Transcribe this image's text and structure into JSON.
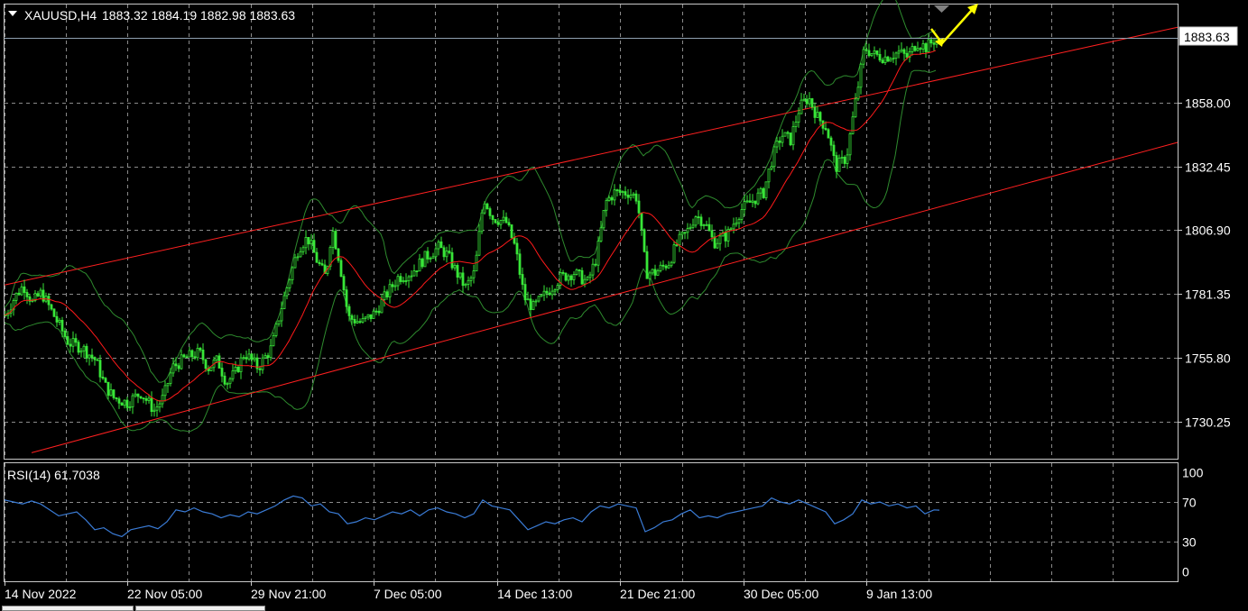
{
  "colors": {
    "background": "#000000",
    "candle": "#39e639",
    "bollinger": "#2e8b2e",
    "ma": "#ff1a1a",
    "channel": "#ff2020",
    "rsi": "#3a7bd5",
    "arrow": "#ffff00",
    "grid": "#8a8a8a",
    "price_line": "#8fa0b0"
  },
  "header": {
    "symbol_label": "XAUUSD,H4",
    "ohlc_text": "1883.32 1884.19 1882.98 1883.63",
    "collapse_icon": "triangle-down-icon"
  },
  "rsi_panel": {
    "label": "RSI(14) 61.7038"
  },
  "price_tag": "1883.63",
  "chart_data": [
    {
      "type": "candlestick",
      "title": "XAUUSD,H4",
      "y_ticks": [
        "1883.63",
        "1858.00",
        "1832.45",
        "1806.90",
        "1781.35",
        "1755.80",
        "1730.25"
      ],
      "ylim": [
        1716,
        1896
      ],
      "x_ticks": [
        "14 Nov 2022",
        "22 Nov 05:00",
        "29 Nov 21:00",
        "7 Dec 05:00",
        "14 Dec 13:00",
        "21 Dec 21:00",
        "30 Dec 05:00",
        "9 Jan 13:00"
      ],
      "last_price": 1883.63,
      "grid": true,
      "close_trace": [
        [
          0,
          1773
        ],
        [
          10,
          1780
        ],
        [
          20,
          1785
        ],
        [
          30,
          1778
        ],
        [
          40,
          1782
        ],
        [
          55,
          1772
        ],
        [
          70,
          1762
        ],
        [
          85,
          1760
        ],
        [
          100,
          1755
        ],
        [
          110,
          1745
        ],
        [
          120,
          1740
        ],
        [
          135,
          1738
        ],
        [
          150,
          1742
        ],
        [
          165,
          1735
        ],
        [
          175,
          1740
        ],
        [
          185,
          1752
        ],
        [
          200,
          1756
        ],
        [
          215,
          1758
        ],
        [
          225,
          1752
        ],
        [
          235,
          1755
        ],
        [
          245,
          1746
        ],
        [
          255,
          1750
        ],
        [
          265,
          1758
        ],
        [
          280,
          1752
        ],
        [
          295,
          1760
        ],
        [
          305,
          1775
        ],
        [
          315,
          1788
        ],
        [
          325,
          1800
        ],
        [
          335,
          1804
        ],
        [
          345,
          1795
        ],
        [
          355,
          1788
        ],
        [
          362,
          1808
        ],
        [
          370,
          1795
        ],
        [
          380,
          1772
        ],
        [
          395,
          1770
        ],
        [
          410,
          1774
        ],
        [
          420,
          1780
        ],
        [
          435,
          1788
        ],
        [
          450,
          1790
        ],
        [
          465,
          1796
        ],
        [
          480,
          1800
        ],
        [
          490,
          1797
        ],
        [
          500,
          1790
        ],
        [
          510,
          1784
        ],
        [
          520,
          1790
        ],
        [
          530,
          1820
        ],
        [
          540,
          1812
        ],
        [
          555,
          1810
        ],
        [
          565,
          1800
        ],
        [
          575,
          1780
        ],
        [
          585,
          1776
        ],
        [
          600,
          1782
        ],
        [
          615,
          1788
        ],
        [
          630,
          1790
        ],
        [
          645,
          1786
        ],
        [
          655,
          1796
        ],
        [
          665,
          1818
        ],
        [
          675,
          1822
        ],
        [
          690,
          1822
        ],
        [
          700,
          1820
        ],
        [
          710,
          1790
        ],
        [
          720,
          1790
        ],
        [
          735,
          1794
        ],
        [
          745,
          1802
        ],
        [
          755,
          1806
        ],
        [
          765,
          1813
        ],
        [
          775,
          1810
        ],
        [
          785,
          1802
        ],
        [
          800,
          1805
        ],
        [
          815,
          1815
        ],
        [
          825,
          1818
        ],
        [
          840,
          1822
        ],
        [
          850,
          1836
        ],
        [
          860,
          1845
        ],
        [
          870,
          1843
        ],
        [
          880,
          1856
        ],
        [
          890,
          1860
        ],
        [
          900,
          1852
        ],
        [
          910,
          1848
        ],
        [
          920,
          1832
        ],
        [
          932,
          1836
        ],
        [
          942,
          1858
        ],
        [
          952,
          1880
        ],
        [
          962,
          1877
        ],
        [
          975,
          1876
        ],
        [
          990,
          1878
        ],
        [
          1000,
          1876
        ],
        [
          1010,
          1882
        ],
        [
          1020,
          1880
        ],
        [
          1032,
          1883.63
        ]
      ],
      "channel_lines": [
        {
          "from": [
            0,
            1785
          ],
          "to": [
            1305,
            1888
          ]
        },
        {
          "from": [
            30,
            1718
          ],
          "to": [
            1305,
            1842
          ]
        }
      ]
    },
    {
      "type": "line",
      "title": "RSI(14) 61.7038",
      "y_ticks": [
        "100",
        "70",
        "30",
        "0"
      ],
      "ylim": [
        0,
        100
      ],
      "last_value": 61.7038,
      "grid": true,
      "trace": [
        [
          0,
          72
        ],
        [
          10,
          70
        ],
        [
          20,
          68
        ],
        [
          30,
          71
        ],
        [
          40,
          68
        ],
        [
          50,
          62
        ],
        [
          60,
          56
        ],
        [
          70,
          58
        ],
        [
          80,
          60
        ],
        [
          90,
          52
        ],
        [
          100,
          42
        ],
        [
          110,
          44
        ],
        [
          120,
          38
        ],
        [
          130,
          35
        ],
        [
          140,
          42
        ],
        [
          150,
          44
        ],
        [
          160,
          46
        ],
        [
          170,
          43
        ],
        [
          180,
          50
        ],
        [
          190,
          62
        ],
        [
          200,
          60
        ],
        [
          210,
          64
        ],
        [
          220,
          60
        ],
        [
          230,
          58
        ],
        [
          240,
          54
        ],
        [
          250,
          57
        ],
        [
          260,
          55
        ],
        [
          270,
          60
        ],
        [
          280,
          58
        ],
        [
          290,
          62
        ],
        [
          300,
          66
        ],
        [
          310,
          72
        ],
        [
          320,
          76
        ],
        [
          330,
          74
        ],
        [
          340,
          66
        ],
        [
          350,
          68
        ],
        [
          360,
          60
        ],
        [
          370,
          58
        ],
        [
          380,
          48
        ],
        [
          390,
          50
        ],
        [
          400,
          54
        ],
        [
          410,
          52
        ],
        [
          420,
          56
        ],
        [
          430,
          60
        ],
        [
          440,
          58
        ],
        [
          450,
          62
        ],
        [
          460,
          56
        ],
        [
          470,
          62
        ],
        [
          480,
          64
        ],
        [
          490,
          60
        ],
        [
          500,
          58
        ],
        [
          510,
          54
        ],
        [
          520,
          58
        ],
        [
          530,
          72
        ],
        [
          540,
          66
        ],
        [
          550,
          64
        ],
        [
          560,
          62
        ],
        [
          570,
          52
        ],
        [
          580,
          42
        ],
        [
          590,
          46
        ],
        [
          600,
          50
        ],
        [
          610,
          48
        ],
        [
          620,
          52
        ],
        [
          630,
          54
        ],
        [
          640,
          50
        ],
        [
          650,
          60
        ],
        [
          660,
          66
        ],
        [
          670,
          64
        ],
        [
          680,
          68
        ],
        [
          690,
          66
        ],
        [
          700,
          64
        ],
        [
          710,
          40
        ],
        [
          720,
          44
        ],
        [
          730,
          50
        ],
        [
          740,
          52
        ],
        [
          750,
          58
        ],
        [
          760,
          62
        ],
        [
          770,
          54
        ],
        [
          780,
          56
        ],
        [
          790,
          54
        ],
        [
          800,
          58
        ],
        [
          810,
          60
        ],
        [
          820,
          62
        ],
        [
          830,
          64
        ],
        [
          840,
          66
        ],
        [
          850,
          74
        ],
        [
          860,
          70
        ],
        [
          870,
          68
        ],
        [
          880,
          72
        ],
        [
          890,
          68
        ],
        [
          900,
          64
        ],
        [
          910,
          60
        ],
        [
          920,
          48
        ],
        [
          930,
          52
        ],
        [
          940,
          58
        ],
        [
          950,
          72
        ],
        [
          960,
          68
        ],
        [
          970,
          70
        ],
        [
          980,
          66
        ],
        [
          990,
          68
        ],
        [
          1000,
          64
        ],
        [
          1010,
          66
        ],
        [
          1020,
          58
        ],
        [
          1030,
          62
        ],
        [
          1036,
          61.7
        ]
      ]
    }
  ]
}
